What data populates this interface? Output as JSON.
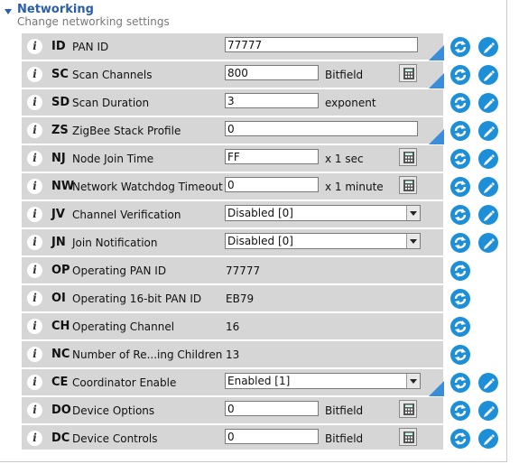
{
  "section": {
    "title": "Networking",
    "subtitle": "Change networking settings"
  },
  "settings": [
    {
      "code": "ID",
      "label": "PAN ID",
      "value": "77777",
      "kind": "text-long",
      "writable": true,
      "modified": true
    },
    {
      "code": "SC",
      "label": "Scan Channels",
      "value": "800",
      "unit": "Bitfield",
      "kind": "text-short",
      "calc": true,
      "writable": true,
      "modified": true
    },
    {
      "code": "SD",
      "label": "Scan Duration",
      "value": "3",
      "unit": "exponent",
      "kind": "text-short",
      "writable": true
    },
    {
      "code": "ZS",
      "label": "ZigBee Stack Profile",
      "value": "0",
      "kind": "text-long",
      "writable": true,
      "modified": true
    },
    {
      "code": "NJ",
      "label": "Node Join Time",
      "value": "FF",
      "unit": "x 1 sec",
      "kind": "text-short",
      "calc": true,
      "writable": true
    },
    {
      "code": "NW",
      "label": "Network Watchdog Timeout",
      "value": "0",
      "unit": "x 1 minute",
      "kind": "text-short",
      "calc": true,
      "writable": true
    },
    {
      "code": "JV",
      "label": "Channel Verification",
      "value": "Disabled [0]",
      "kind": "select",
      "writable": true
    },
    {
      "code": "JN",
      "label": "Join Notification",
      "value": "Disabled [0]",
      "kind": "select",
      "writable": true
    },
    {
      "code": "OP",
      "label": "Operating PAN ID",
      "value": "77777",
      "kind": "readonly",
      "writable": false
    },
    {
      "code": "OI",
      "label": "Operating 16-bit PAN ID",
      "value": "EB79",
      "kind": "readonly",
      "writable": false
    },
    {
      "code": "CH",
      "label": "Operating Channel",
      "value": "16",
      "kind": "readonly",
      "writable": false
    },
    {
      "code": "NC",
      "label": "Number of Re...ing Children",
      "value": "13",
      "kind": "readonly",
      "writable": false
    },
    {
      "code": "CE",
      "label": "Coordinator Enable",
      "value": "Enabled [1]",
      "kind": "select",
      "writable": true,
      "modified": true
    },
    {
      "code": "DO",
      "label": "Device Options",
      "value": "0",
      "unit": "Bitfield",
      "kind": "text-short",
      "calc": true,
      "writable": true
    },
    {
      "code": "DC",
      "label": "Device Controls",
      "value": "0",
      "unit": "Bitfield",
      "kind": "text-short",
      "calc": true,
      "writable": true
    }
  ],
  "icons": {
    "info": "i",
    "read": "refresh-icon",
    "write": "pencil-icon",
    "calculator": "calculator-icon"
  },
  "colors": {
    "accent": "#2a5ea8",
    "row": "#d6d6d6",
    "button": "#1c8fd8",
    "modified_marker": "#3a8dd8"
  }
}
